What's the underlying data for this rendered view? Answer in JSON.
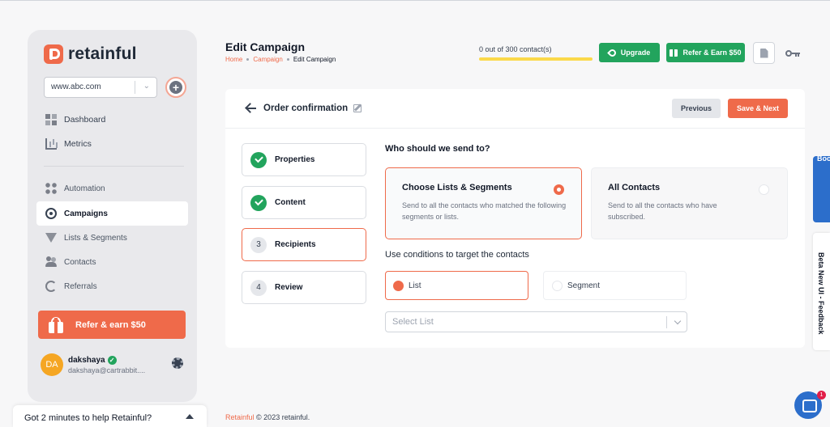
{
  "brand": {
    "logo_text": "retainful",
    "accent": "#ef6a4a"
  },
  "sidebar": {
    "site_select": {
      "value": "www.abc.com"
    },
    "nav_top": [
      {
        "label": "Dashboard",
        "icon": "dashboard-icon"
      },
      {
        "label": "Metrics",
        "icon": "metrics-icon"
      }
    ],
    "nav_main": [
      {
        "label": "Automation",
        "icon": "automation-icon"
      },
      {
        "label": "Campaigns",
        "icon": "campaigns-icon",
        "active": true
      },
      {
        "label": "Lists & Segments",
        "icon": "filter-icon"
      },
      {
        "label": "Contacts",
        "icon": "contacts-icon"
      },
      {
        "label": "Referrals",
        "icon": "referrals-icon"
      }
    ],
    "refer_label": "Refer & earn $50",
    "user": {
      "initials": "DA",
      "name": "dakshaya",
      "email": "dakshaya@cartrabbit...."
    }
  },
  "help_bar": {
    "label": "Got 2 minutes to help Retainful?"
  },
  "header": {
    "title": "Edit Campaign",
    "breadcrumb": [
      "Home",
      "Campaign",
      "Edit Campaign"
    ],
    "contacts_text": "0 out of 300 contact(s)",
    "contacts_used": 0,
    "upgrade_label": "Upgrade",
    "refer_label": "Refer & Earn $50"
  },
  "campaign": {
    "name": "Order confirmation",
    "previous_label": "Previous",
    "save_next_label": "Save & Next",
    "steps": [
      {
        "label": "Properties",
        "status": "done"
      },
      {
        "label": "Content",
        "status": "done"
      },
      {
        "num": "3",
        "label": "Recipients",
        "status": "active"
      },
      {
        "num": "4",
        "label": "Review",
        "status": "pending"
      }
    ],
    "question": "Who should we send to?",
    "options": [
      {
        "title": "Choose Lists & Segments",
        "desc": "Send to all the contacts who matched the following segments or lists.",
        "selected": true
      },
      {
        "title": "All Contacts",
        "desc": "Send to all the contacts who have subscribed.",
        "selected": false
      }
    ],
    "conditions_title": "Use conditions to target the contacts",
    "target_options": [
      {
        "label": "List",
        "selected": true
      },
      {
        "label": "Segment",
        "selected": false
      }
    ],
    "select_placeholder": "Select List"
  },
  "footer": {
    "brand": "Retainful",
    "text": "© 2023 retainful."
  },
  "right_tabs": {
    "book_call": "Book a call",
    "feedback": "Beta New UI - Feedback"
  },
  "chat": {
    "badge": "1"
  }
}
